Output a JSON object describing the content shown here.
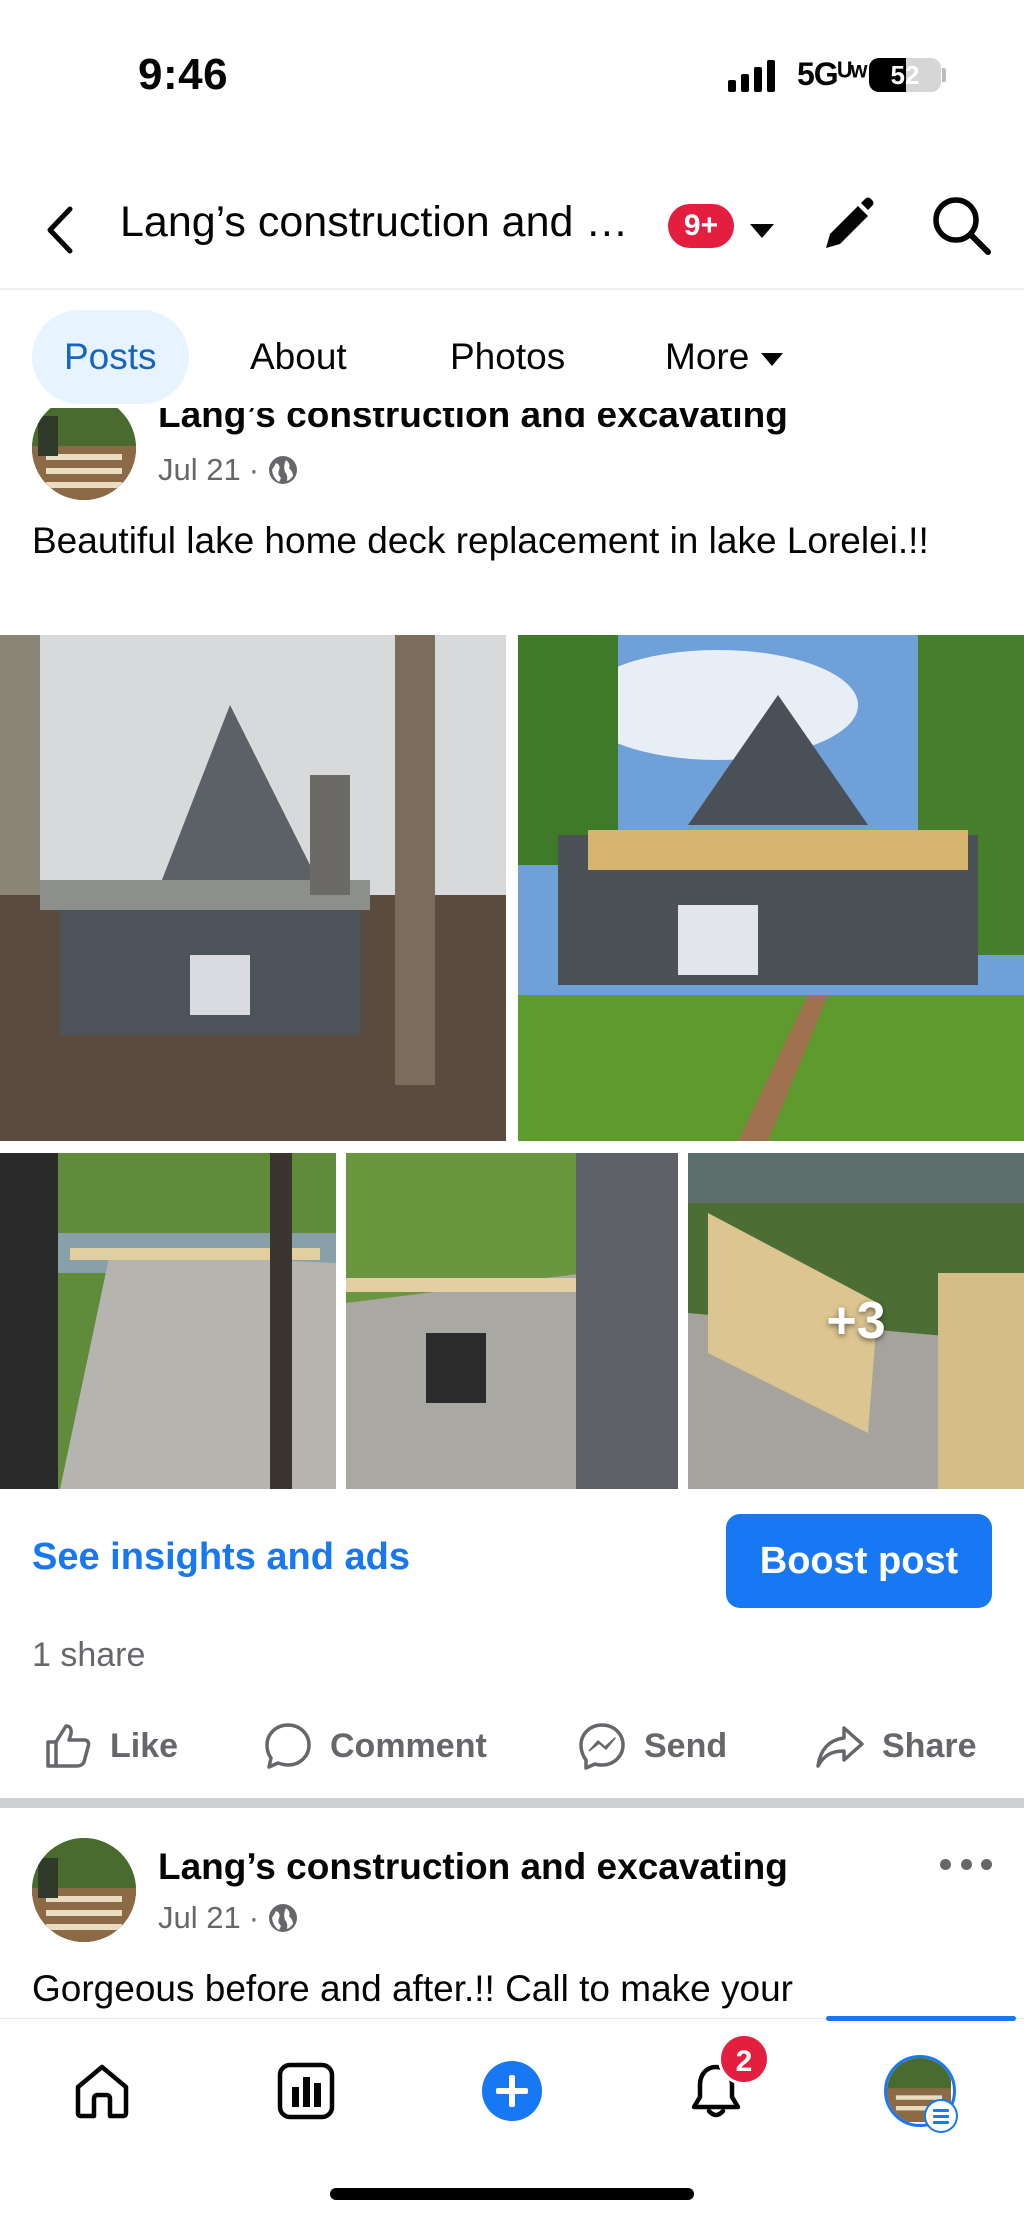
{
  "status_bar": {
    "time": "9:46",
    "network": "5Gᵁʷ",
    "battery": "52",
    "battery_fraction": 0.52
  },
  "header": {
    "title": "Lang’s construction and excavating",
    "notification_badge": "9+",
    "icons": [
      "back-icon",
      "chevron-down-icon",
      "pencil-icon",
      "search-icon"
    ]
  },
  "tabs": [
    {
      "label": "Posts",
      "active": true
    },
    {
      "label": "About",
      "active": false
    },
    {
      "label": "Photos",
      "active": false
    },
    {
      "label": "More",
      "active": false
    }
  ],
  "post1": {
    "author": "Lang’s construction and excavating",
    "date": "Jul 21",
    "separator": "·",
    "visibility_icon": "globe-icon",
    "text": "Beautiful lake home deck replacement in lake Lorelei.!!",
    "photos_more": "+3",
    "insights_link": "See insights and ads",
    "boost_button": "Boost post",
    "shares": "1 share",
    "actions": {
      "like": "Like",
      "comment": "Comment",
      "send": "Send",
      "share": "Share"
    }
  },
  "post2": {
    "author": "Lang’s construction and excavating",
    "date": "Jul 21",
    "separator": "·",
    "visibility_icon": "globe-icon",
    "text": "Gorgeous before and after.!! Call to make your"
  },
  "bottom_nav": {
    "items": [
      "home-icon",
      "dashboard-icon",
      "create-icon",
      "notifications-icon",
      "profile-icon"
    ],
    "notifications_badge": "2",
    "active": "profile"
  },
  "colors": {
    "accent": "#1877f2",
    "badge": "#e41e3f",
    "active_tab_bg": "#e7f3ff",
    "muted_text": "#65676b"
  }
}
